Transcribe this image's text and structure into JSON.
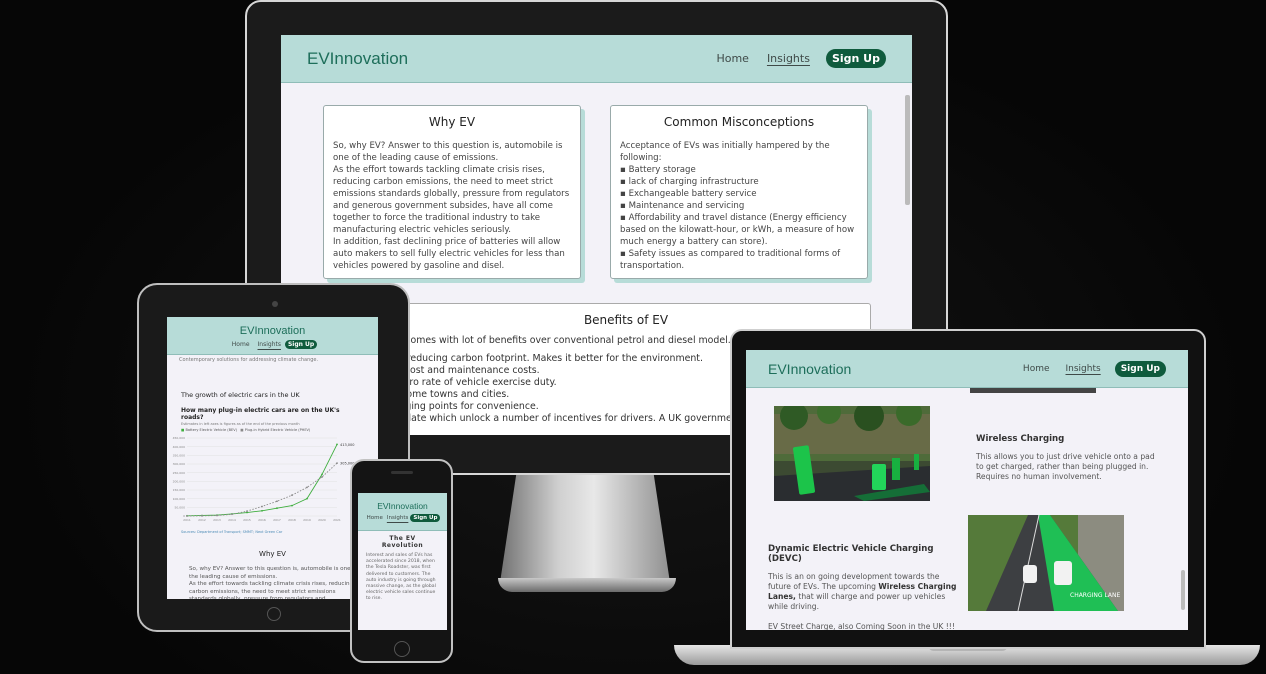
{
  "site": {
    "brand": "EVInnovation",
    "nav": {
      "home": "Home",
      "insights": "Insights",
      "signup": "Sign Up"
    }
  },
  "monitor": {
    "why_ev": {
      "title": "Why EV",
      "text": "So, why EV? Answer to this question is, automobile is one of the leading cause of emissions.\nAs the effort towards tackling climate crisis rises, reducing carbon emissions, the need to meet strict emissions standards globally, pressure from regulators and generous government subsides, have all come together to force the traditional industry to take manufacturing electric vehicles seriously.\nIn addition, fast declining price of batteries will allow auto makers to sell fully electric vehicles for less than vehicles powered by gasoline and disel."
    },
    "misconceptions": {
      "title": "Common Misconceptions",
      "intro": "Acceptance of EVs was initially hampered by the following:",
      "items": [
        "Battery storage",
        "lack of charging infrastructure",
        "Exchangeable battery service",
        "Maintenance and servicing",
        "Affordability and travel distance (Energy efficiency based on the kilowatt-hour, or kWh, a measure of how much energy a battery can store).",
        "Safety issues as compared to traditional forms of transportation."
      ]
    },
    "benefits": {
      "title": "Benefits of EV",
      "intro": "EV comes with lot of benefits over conventional petrol and diesel model.",
      "items": [
        "hs, reducing carbon footprint. Makes it better for the environment.",
        "ng cost and maintenance costs.",
        "e zero rate of vehicle exercise duty.",
        "in some towns and cities.",
        "harging points for convenience.",
        "er plate which unlock a number of incentives for drivers. A UK government in"
      ]
    }
  },
  "tablet": {
    "subtitle": "Contemporary solutions for addressing climate change.",
    "growth_title": "The growth of electric cars in the UK",
    "chart_title": "How many plug-in electric cars are on the UK's roads?",
    "chart_note": "Estimates in left axes is figures as of the end of the previous month",
    "legend_bev": "Battery Electric Vehicle (BEV)",
    "legend_phev": "Plug-in Hybrid Electric Vehicle (PHEV)",
    "val_bev": "413,000",
    "val_phev": "305,000",
    "source": "Sources: Department of Transport; SMMT; Next Green Car",
    "why_title": "Why EV",
    "why_text": "So, why EV? Answer to this question is, automobile is one of the leading cause of emissions.\nAs the effort towards tackling climate crisis rises, reducing carbon emissions, the need to meet strict emissions standards globally, pressure from regulators and"
  },
  "phone": {
    "section_title": "The EV Revolution",
    "text": "Interest and sales of EVs has accelerated since 2018, when the Tesla Roadster, was first delivered to customers. The auto industry is going through massive change, as the global electric vehicle sales continue to rise."
  },
  "laptop": {
    "wireless_title": "Wireless Charging",
    "wireless_text": "This allows you to just drive vehicle onto a pad to get charged, rather than being plugged in. Requires no human involvement.",
    "devc_title": "Dynamic Electric Vehicle Charging (DEVC)",
    "devc_text_1": "This is an on going development towards the future of EVs. The upcoming ",
    "devc_bold": "Wireless Charging Lanes,",
    "devc_text_2": " that will charge and power up vehicles while driving.",
    "street": "EV Street Charge, also Coming Soon in the UK !!!",
    "lane_label": "CHARGING LANE"
  },
  "chart_data": {
    "type": "line",
    "title": "How many plug-in electric cars are on the UK's roads?",
    "x": [
      "2011",
      "2012",
      "2013",
      "2014",
      "2015",
      "2016",
      "2017",
      "2018",
      "2019",
      "2020",
      "2021"
    ],
    "series": [
      {
        "name": "Battery Electric Vehicle (BEV)",
        "values": [
          1000,
          3000,
          5000,
          12000,
          20000,
          30000,
          45000,
          60000,
          100000,
          240000,
          413000
        ]
      },
      {
        "name": "Plug-in Hybrid Electric Vehicle (PHEV)",
        "values": [
          0,
          1000,
          3000,
          10000,
          28000,
          55000,
          85000,
          120000,
          165000,
          225000,
          305000
        ]
      }
    ],
    "ylim": [
      0,
      450000
    ],
    "legend": "top-left",
    "colors": {
      "bev": "#3fae3f",
      "phev": "#8a8a8a"
    }
  }
}
